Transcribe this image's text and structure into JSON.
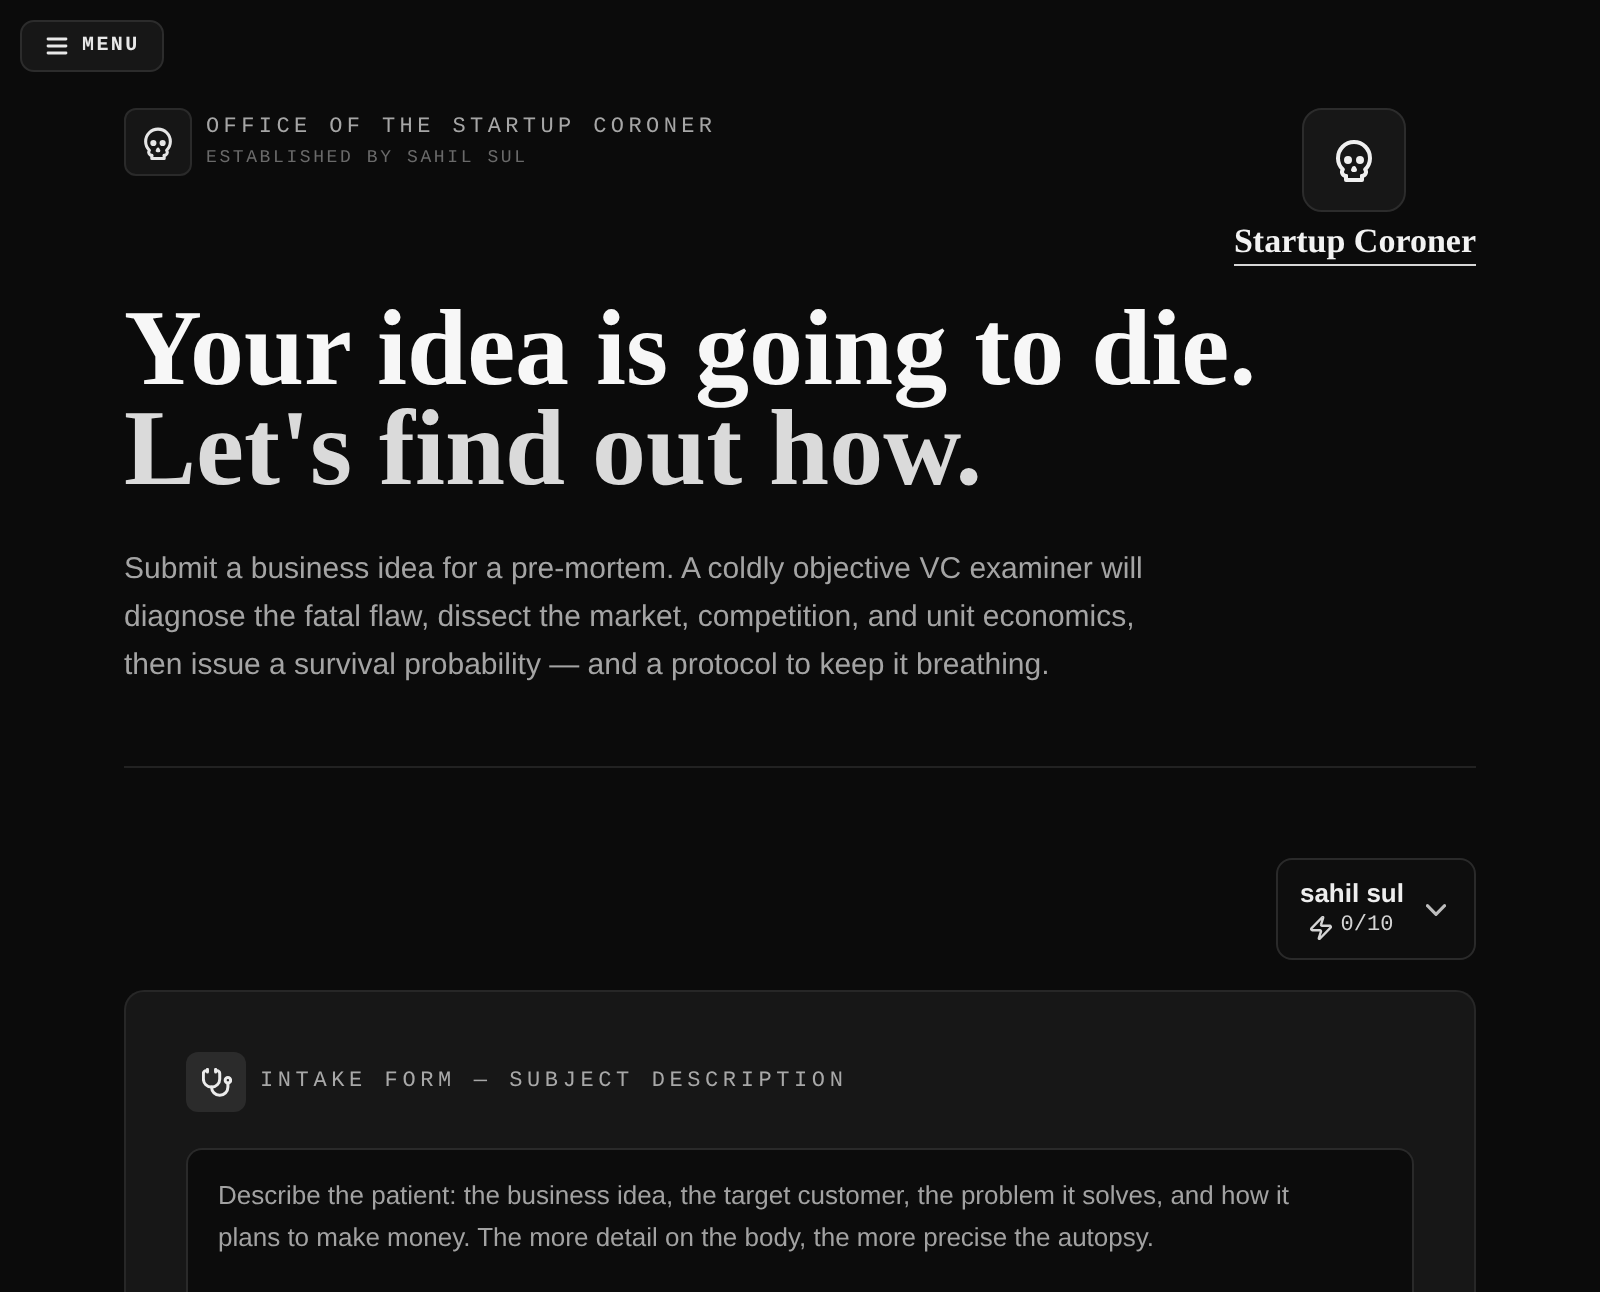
{
  "menu_button": {
    "label": "MENU"
  },
  "header": {
    "office_title": "OFFICE OF THE STARTUP CORONER",
    "established": "ESTABLISHED BY SAHIL SUL",
    "brand": "Startup Coroner"
  },
  "hero": {
    "headline": [
      "Your idea is going to die.",
      "Let's find out how."
    ],
    "description": "Submit a business idea for a pre-mortem. A coldly objective VC examiner will diagnose the fatal flaw, dissect the market, competition, and unit economics, then issue a survival probability — and a protocol to keep it breathing."
  },
  "user_menu": {
    "name": "sahil sul",
    "credits": "0/10"
  },
  "intake_form": {
    "title": "INTAKE FORM — SUBJECT DESCRIPTION",
    "description_field": {
      "placeholder": "Describe the patient: the business idea, the target customer, the problem it solves, and how it plans to make money. The more detail on the body, the more precise the autopsy."
    }
  }
}
